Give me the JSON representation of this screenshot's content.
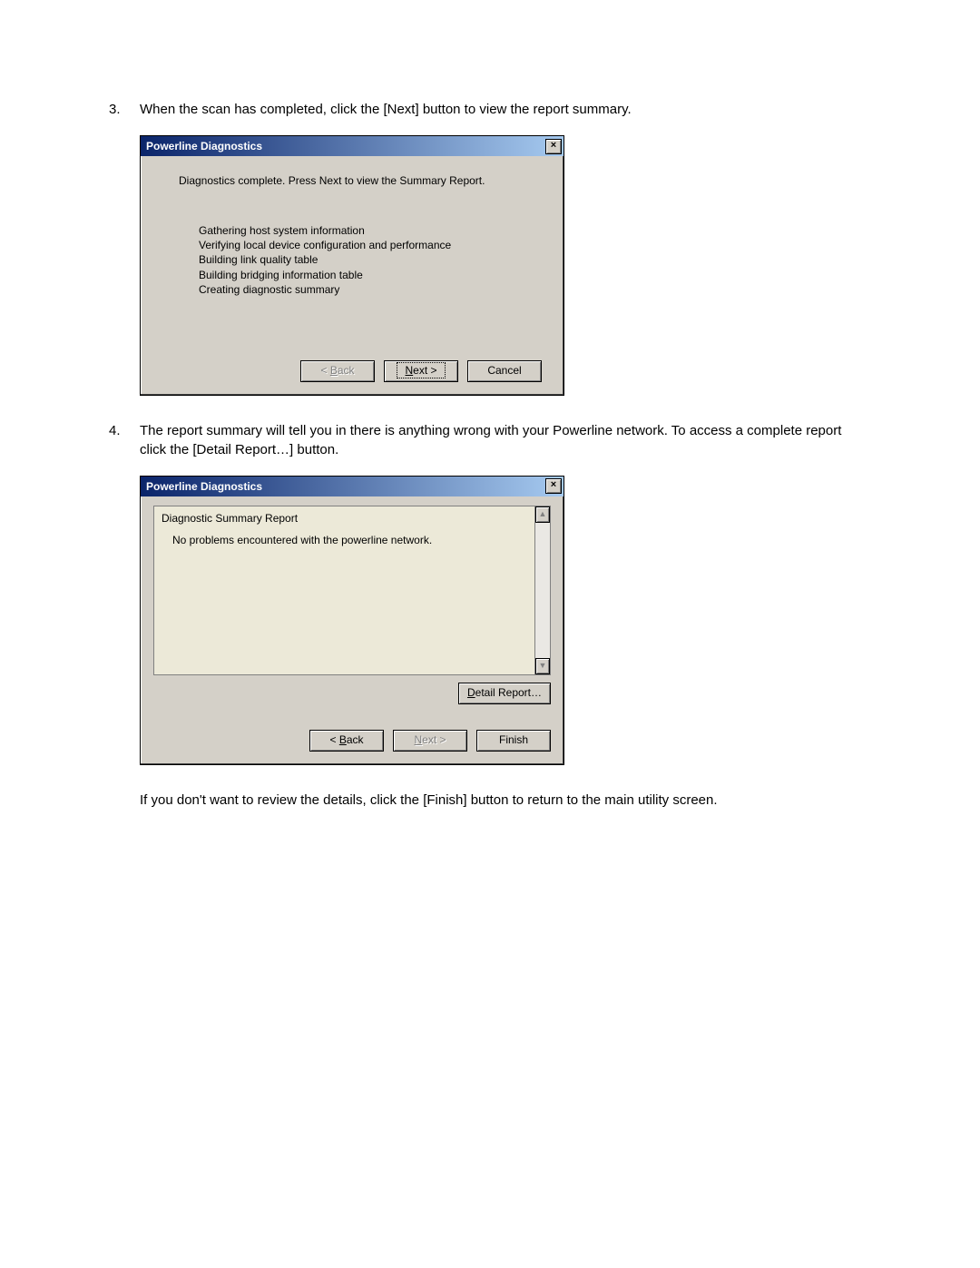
{
  "steps": {
    "s3": {
      "num": "3.",
      "text": "When the scan has completed, click the [Next] button to view the report summary."
    },
    "s4": {
      "num": "4.",
      "text": "The report summary will tell you in there is anything wrong with your Powerline network. To access a complete report click the [Detail Report…] button."
    },
    "closing": "If you don't want to review the details, click the [Finish] button to return to the main utility screen."
  },
  "dialog1": {
    "title": "Powerline Diagnostics",
    "close": "×",
    "message": "Diagnostics complete. Press Next to view the Summary Report.",
    "items": [
      "Gathering host system information",
      "Verifying local device configuration and performance",
      "Building link quality table",
      "Building bridging information table",
      "Creating diagnostic summary"
    ],
    "buttons": {
      "back_lt": "< ",
      "back_u": "B",
      "back_rest": "ack",
      "next_u": "N",
      "next_rest": "ext >",
      "cancel": "Cancel"
    }
  },
  "dialog2": {
    "title": "Powerline Diagnostics",
    "close": "×",
    "report_header": "Diagnostic Summary Report",
    "report_line": "No problems encountered with the powerline network.",
    "scroll_up": "▲",
    "scroll_down": "▼",
    "detail_u": "D",
    "detail_rest": "etail Report…",
    "buttons": {
      "back_lt": "< ",
      "back_u": "B",
      "back_rest": "ack",
      "next_u": "N",
      "next_rest": "ext >",
      "finish": "Finish"
    }
  }
}
